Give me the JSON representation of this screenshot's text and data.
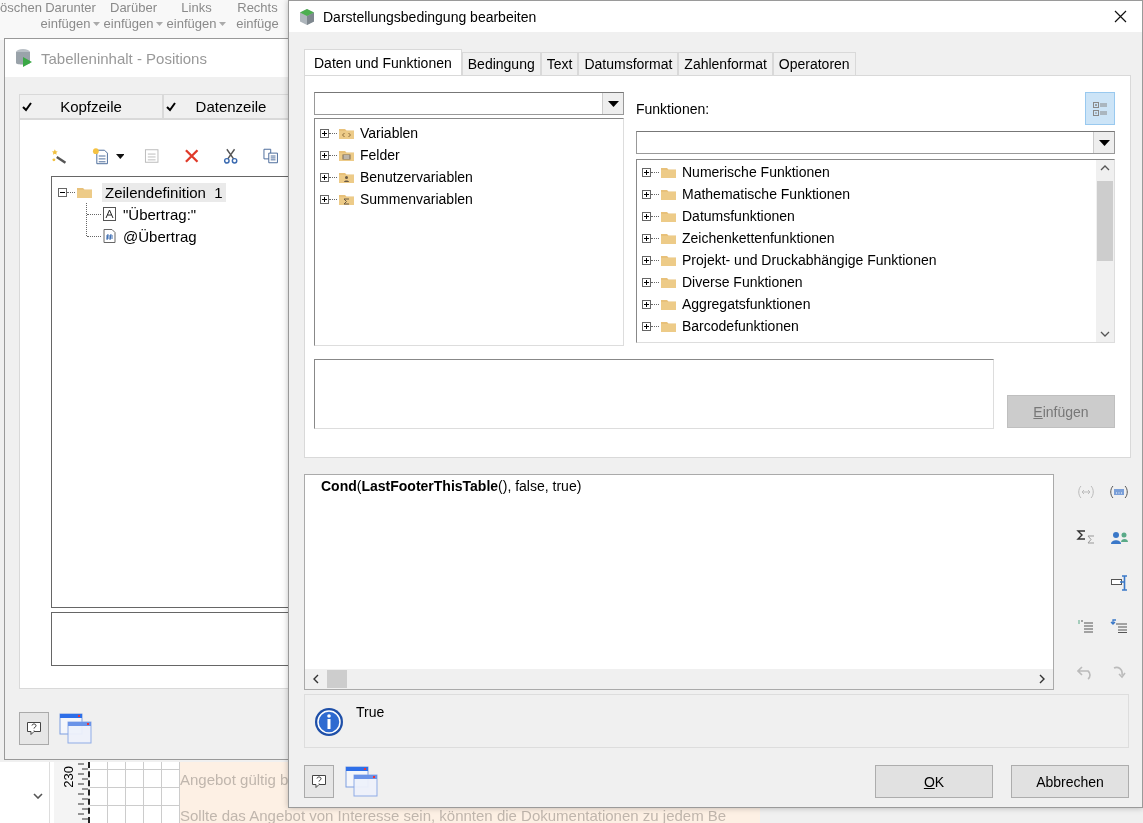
{
  "background_app": {
    "ribbon": [
      {
        "line1": "öschen",
        "dropdown": false
      },
      {
        "line1": "Darunter",
        "line2": "einfügen",
        "dropdown": true
      },
      {
        "line1": "Darüber",
        "line2": "einfügen",
        "dropdown": true
      },
      {
        "line1": "Links",
        "line2": "einfügen",
        "dropdown": true
      },
      {
        "line1": "Rechts",
        "line2": "einfüge",
        "dropdown": false
      }
    ],
    "ruler_label": "230",
    "document_lines": [
      "Angebot gültig b",
      "Sollte das Angebot von Interesse sein, könnten die Dokumentationen zu jedem Be"
    ]
  },
  "table_window": {
    "title": "Tabelleninhalt - Positions",
    "tabs": [
      {
        "label": "Kopfzeile",
        "checked": true
      },
      {
        "label": "Datenzeile",
        "checked": true
      }
    ],
    "tree": [
      {
        "label": "Zeilendefinition  1",
        "kind": "folder",
        "expanded": true,
        "selected": true,
        "children": [
          {
            "label": "\"Übertrag:\"",
            "kind": "text",
            "selected": false
          },
          {
            "label": "@Übertrag",
            "kind": "field",
            "selected": false
          }
        ]
      }
    ]
  },
  "dialog": {
    "title": "Darstellungsbedingung bearbeiten",
    "tabs": [
      {
        "label": "Daten und Funktionen",
        "selected": true
      },
      {
        "label": "Bedingung",
        "selected": false
      },
      {
        "label": "Text",
        "selected": false
      },
      {
        "label": "Datumsformat",
        "selected": false
      },
      {
        "label": "Zahlenformat",
        "selected": false
      },
      {
        "label": "Operatoren",
        "selected": false
      }
    ],
    "data_tree": [
      {
        "label": "Variablen",
        "kind": "variables",
        "expanded": false
      },
      {
        "label": "Felder",
        "kind": "fields",
        "expanded": false
      },
      {
        "label": "Benutzervariablen",
        "kind": "user",
        "expanded": false
      },
      {
        "label": "Summenvariablen",
        "kind": "sum",
        "expanded": false
      }
    ],
    "functions_label": "Funktionen:",
    "function_tree": [
      {
        "label": "Numerische Funktionen",
        "expanded": false
      },
      {
        "label": "Mathematische Funktionen",
        "expanded": false
      },
      {
        "label": "Datumsfunktionen",
        "expanded": false
      },
      {
        "label": "Zeichenkettenfunktionen",
        "expanded": false
      },
      {
        "label": "Projekt- und Druckabhängige Funktionen",
        "expanded": false
      },
      {
        "label": "Diverse Funktionen",
        "expanded": false
      },
      {
        "label": "Aggregatsfunktionen",
        "expanded": false
      },
      {
        "label": "Barcodefunktionen",
        "expanded": false
      }
    ],
    "insert_button": {
      "label": "Einfügen",
      "disabled": true
    },
    "expression": "**Cond**(**LastFooterThisTable**(), false, true)",
    "result": "True",
    "ok_button": "OK",
    "cancel_button": "Abbrechen"
  }
}
